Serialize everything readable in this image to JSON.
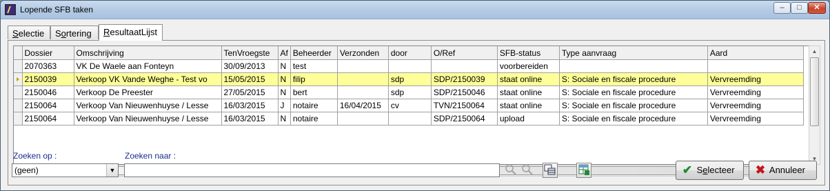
{
  "window": {
    "title": "Lopende SFB taken",
    "controls": {
      "minimize": "–",
      "maximize": "□",
      "close": "✕"
    }
  },
  "tabs": [
    {
      "label": "Selectie",
      "underline": "S",
      "rest": "electie"
    },
    {
      "label": "Sortering",
      "pre": "S",
      "underline": "o",
      "rest": "rtering"
    },
    {
      "label": "ResultaatLijst",
      "underline": "R",
      "rest": "esultaatLijst",
      "active": true
    }
  ],
  "grid": {
    "columns": [
      "Dossier",
      "Omschrijving",
      "TenVroegste",
      "Af",
      "Beheerder",
      "Verzonden",
      "door",
      "O/Ref",
      "SFB-status",
      "Type aanvraag",
      "Aard"
    ],
    "rows": [
      [
        "2070363",
        "VK De Waele aan Fonteyn",
        "30/09/2013",
        "N",
        "test",
        "",
        "",
        "",
        "voorbereiden",
        "",
        ""
      ],
      [
        "2150039",
        "Verkoop VK Vande Weghe - Test vo",
        "15/05/2015",
        "N",
        "filip",
        "",
        "sdp",
        "SDP/2150039",
        "staat online",
        "S: Sociale en fiscale procedure",
        "Vervreemding"
      ],
      [
        "2150046",
        "Verkoop De Preester",
        "27/05/2015",
        "N",
        "bert",
        "",
        "sdp",
        "SDP/2150046",
        "staat online",
        "S: Sociale en fiscale procedure",
        "Vervreemding"
      ],
      [
        "2150064",
        "Verkoop Van Nieuwenhuyse / Lesse",
        "16/03/2015",
        "J",
        "notaire",
        "16/04/2015",
        "cv",
        "TVN/2150064",
        "staat online",
        "S: Sociale en fiscale procedure",
        "Vervreemding"
      ],
      [
        "2150064",
        "Verkoop Van Nieuwenhuyse / Lesse",
        "16/03/2015",
        "N",
        "notaire",
        "",
        "",
        "SDP/2150064",
        "upload",
        "S: Sociale en fiscale procedure",
        "Vervreemding"
      ]
    ],
    "selected_row": 1
  },
  "search": {
    "zoeken_op_label": "Zoeken op :",
    "zoeken_op_value": "(geen)",
    "zoeken_naar_label": "Zoeken naar :",
    "zoeken_naar_value": ""
  },
  "buttons": {
    "select_pre": "S",
    "select_underline": "e",
    "select_rest": "lecteer",
    "select_label": "Selecteer",
    "cancel_label": "Annuleer"
  },
  "icons": {
    "find_prev": "search-prev-icon",
    "find_next": "search-next-icon",
    "copy": "copy-grid-icon",
    "export": "excel-export-icon",
    "select": "checkmark-icon",
    "cancel": "x-icon"
  },
  "colors": {
    "selected_row": "#ffff99",
    "label_blue": "#1b2b8c",
    "check_green": "#1e8a2e",
    "cancel_red": "#c3161c"
  }
}
